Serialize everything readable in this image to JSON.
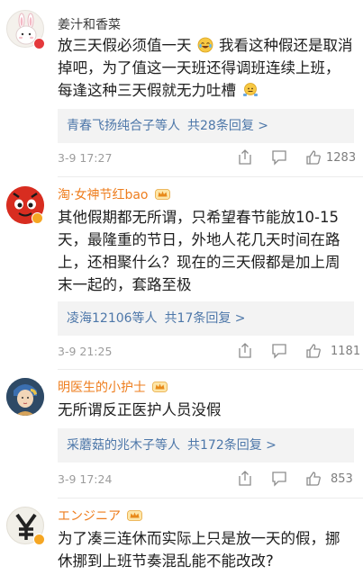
{
  "comments": [
    {
      "username": "姜汁和香菜",
      "lines": [
        "放三天假必须值一天",
        "我看这种假还是取消",
        "掉吧，为了值这一天班还得调班连续上班，",
        "每逢这种三天假就无力吐槽"
      ],
      "replies_who": "青春飞扬纯合子等人",
      "replies_count": "共28条回复 >",
      "time": "3-9 17:27",
      "likes": "1283"
    },
    {
      "username": "淘·女神节红bao",
      "lines": [
        "其他假期都无所谓，只希望春节能放10-15",
        "天，最隆重的节日，外地人花几天时间在路",
        "上，还相聚什么？现在的三天假都是加上周",
        "末一起的，套路至极"
      ],
      "replies_who": "凌海12106等人",
      "replies_count": "共17条回复 >",
      "time": "3-9 21:25",
      "likes": "1181"
    },
    {
      "username": "明医生的小护士",
      "lines": [
        "无所谓反正医护人员没假"
      ],
      "replies_who": "采蘑菇的兆木子等人",
      "replies_count": "共172条回复 >",
      "time": "3-9 17:24",
      "likes": "853"
    },
    {
      "username": "エンジニア",
      "lines": [
        "为了凑三连休而实际上只是放一天的假，挪",
        "休挪到上班节奏混乱能不能改改?"
      ]
    }
  ],
  "icons": {
    "share": "share-icon",
    "comment": "comment-icon",
    "like": "thumbs-up-icon",
    "crown": "vip-crown-icon",
    "emoji_laugh": "laugh-cry-emoji-icon",
    "emoji_shrug": "shrug-emoji-icon"
  },
  "colors": {
    "vip_name": "#ee7d1d",
    "link_blue": "#4d77a9",
    "reply_bg": "#f3f3f3",
    "meta_gray": "#9c9c9c"
  }
}
